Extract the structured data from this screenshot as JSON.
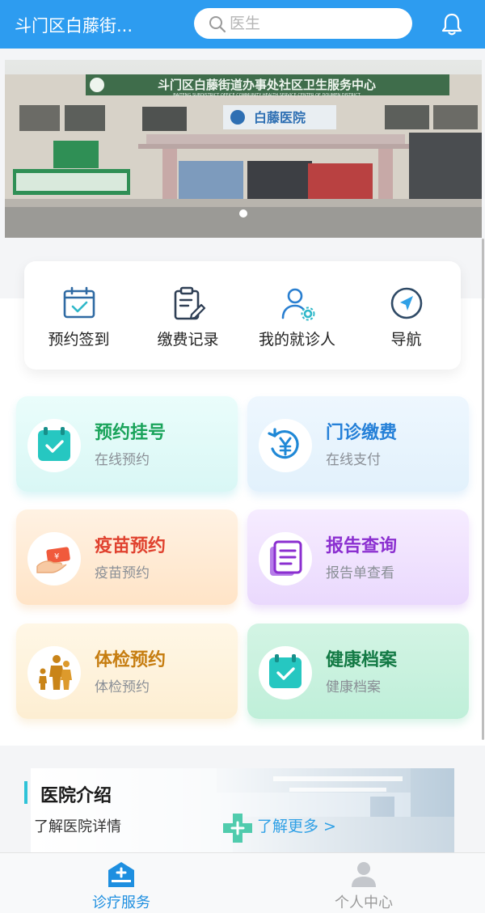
{
  "header": {
    "title": "斗门区白藤街...",
    "search_placeholder": "医生",
    "bell_icon": "bell-icon"
  },
  "banner": {
    "sign_text": "斗门区白藤街道办事处社区卫生服务中心",
    "sign_en": "BAITENG SUBDISTRICT OFFICE COMMUNITY HEALTH SERVICE CENTER OF DOUMEN DISTRICT",
    "hospital_sign": "白藤医院",
    "slide_count": 1,
    "active_slide": 1
  },
  "quick_actions": [
    {
      "label": "预约签到",
      "icon": "calendar-check-icon"
    },
    {
      "label": "缴费记录",
      "icon": "clipboard-edit-icon"
    },
    {
      "label": "我的就诊人",
      "icon": "user-gear-icon"
    },
    {
      "label": "导航",
      "icon": "compass-icon"
    }
  ],
  "services": [
    {
      "title": "预约挂号",
      "subtitle": "在线预约",
      "color": "#19a35a",
      "icon": "calendar-check-icon"
    },
    {
      "title": "门诊缴费",
      "subtitle": "在线支付",
      "color": "#2580d8",
      "icon": "yen-refresh-icon"
    },
    {
      "title": "疫苗预约",
      "subtitle": "疫苗预约",
      "color": "#e0422f",
      "icon": "hand-money-icon"
    },
    {
      "title": "报告查询",
      "subtitle": "报告单查看",
      "color": "#8b2fd0",
      "icon": "report-doc-icon"
    },
    {
      "title": "体检预约",
      "subtitle": "体检预约",
      "color": "#c67d10",
      "icon": "family-icon"
    },
    {
      "title": "健康档案",
      "subtitle": "健康档案",
      "color": "#137a45",
      "icon": "calendar-check-icon"
    }
  ],
  "intro": {
    "title": "医院介绍",
    "subtitle": "了解医院详情",
    "more": "了解更多 >"
  },
  "tabs": [
    {
      "label": "诊疗服务",
      "active": true,
      "icon": "hospital-icon"
    },
    {
      "label": "个人中心",
      "active": false,
      "icon": "person-icon"
    }
  ],
  "colors": {
    "brand": "#2d9cf0",
    "accent_teal": "#2fc3d8",
    "tab_active": "#1e8fe0"
  }
}
